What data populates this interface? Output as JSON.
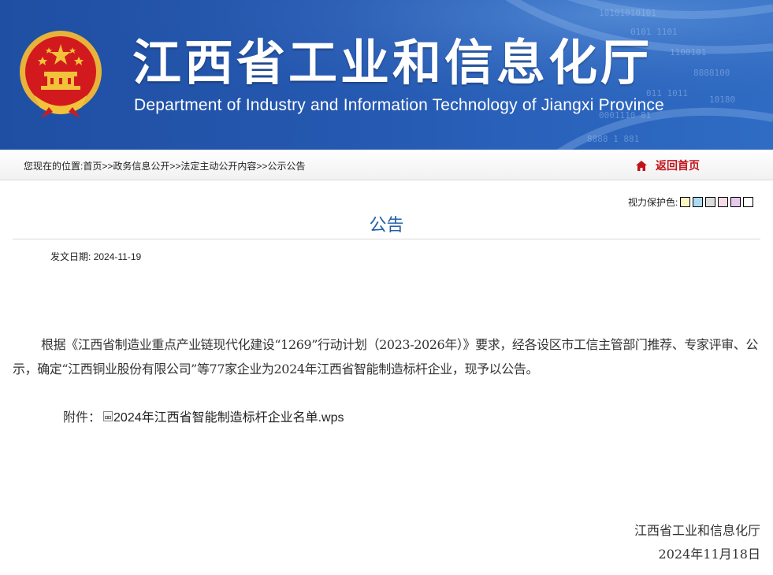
{
  "header": {
    "title_cn": "江西省工业和信息化厅",
    "title_en": "Department of Industry and Information Technology of Jiangxi Province",
    "colors": {
      "banner": "#2558b0",
      "emblem_red": "#d21a1e",
      "emblem_gold": "#f2c23a"
    }
  },
  "breadcrumb": {
    "prefix": "您现在的位置:",
    "items": [
      "首页",
      "政务信息公开",
      "法定主动公开内容",
      "公示公告"
    ],
    "separator": ">>"
  },
  "home_link": {
    "label": "返回首页",
    "icon": "home-icon",
    "color": "#c0141a"
  },
  "vision": {
    "label": "视力保护色:",
    "swatches": [
      "#fdf6c3",
      "#a9dcf2",
      "#dcdcdc",
      "#f4dbe6",
      "#e7c9f0",
      "#ffffff"
    ]
  },
  "article": {
    "title": "公告",
    "date_label": "发文日期:",
    "date": "2024-11-19",
    "body": "根据《江西省制造业重点产业链现代化建设“1269”行动计划（2023-2026年）》要求，经各设区市工信主管部门推荐、专家评审、公示，确定“江西铜业股份有限公司”等77家企业为2024年江西省智能制造标杆企业，现予以公告。",
    "attachment_label": "附件：",
    "attachment_name": "2024年江西省智能制造标杆企业名单.wps",
    "signature_org": "江西省工业和信息化厅",
    "signature_date": "2024年11月18日"
  }
}
